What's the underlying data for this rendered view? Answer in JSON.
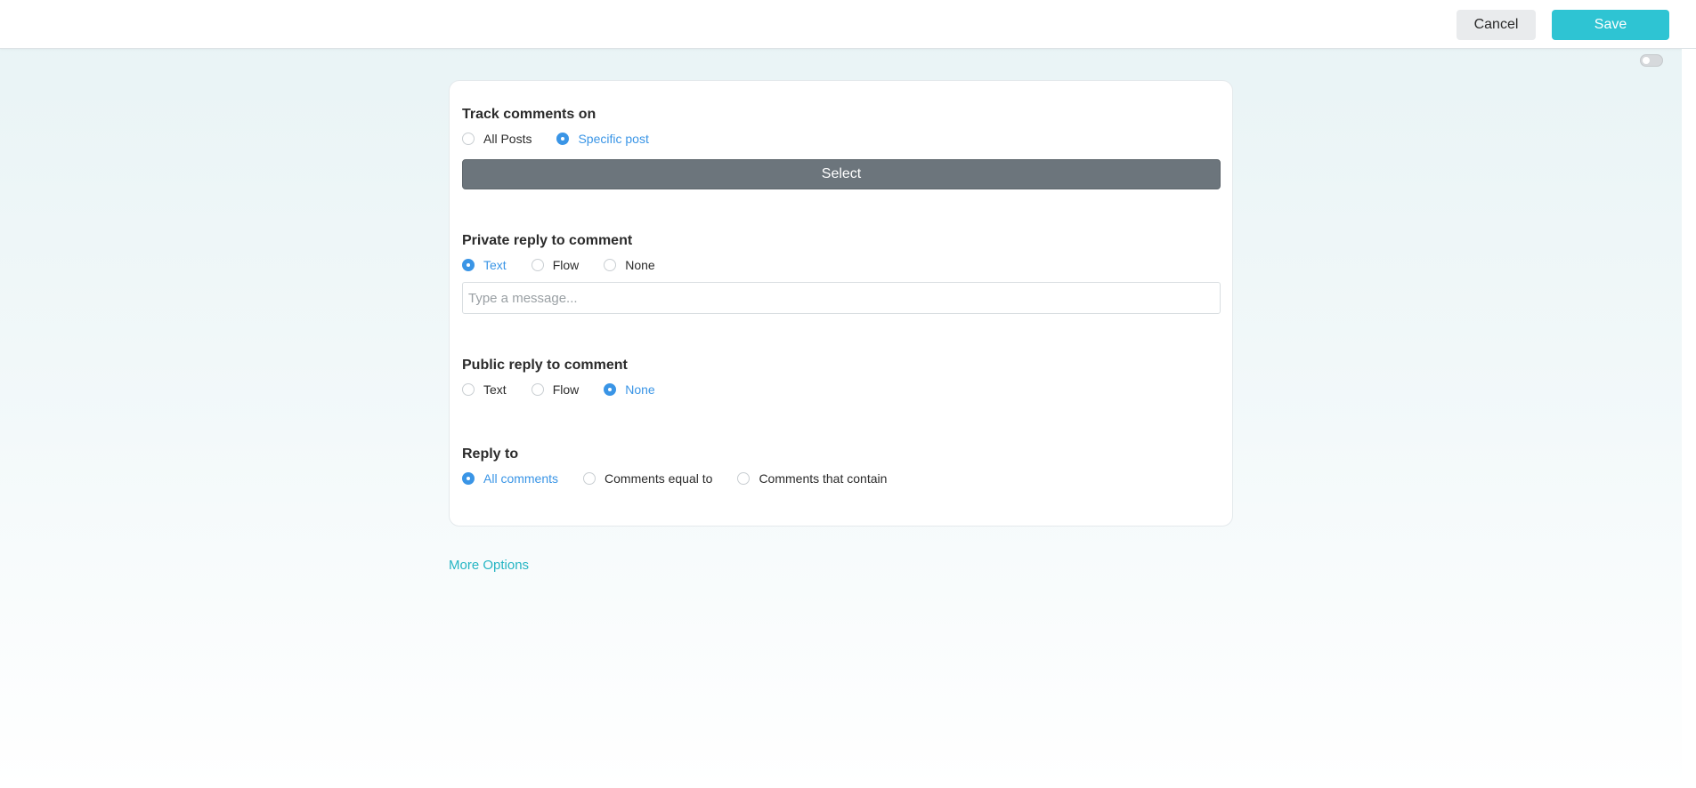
{
  "header": {
    "cancel_label": "Cancel",
    "save_label": "Save"
  },
  "track": {
    "title": "Track comments on",
    "options": [
      "All Posts",
      "Specific post"
    ],
    "selected": "Specific post",
    "select_label": "Select"
  },
  "private_reply": {
    "title": "Private reply to comment",
    "options": [
      "Text",
      "Flow",
      "None"
    ],
    "selected": "Text",
    "placeholder": "Type a message..."
  },
  "public_reply": {
    "title": "Public reply to comment",
    "options": [
      "Text",
      "Flow",
      "None"
    ],
    "selected": "None"
  },
  "reply_to": {
    "title": "Reply to",
    "options": [
      "All comments",
      "Comments equal to",
      "Comments that contain"
    ],
    "selected": "All comments"
  },
  "more_options_label": "More Options",
  "colors": {
    "accent": "#2ec4d3",
    "radio_checked": "#3a95e6",
    "select_button": "#6c757c"
  }
}
